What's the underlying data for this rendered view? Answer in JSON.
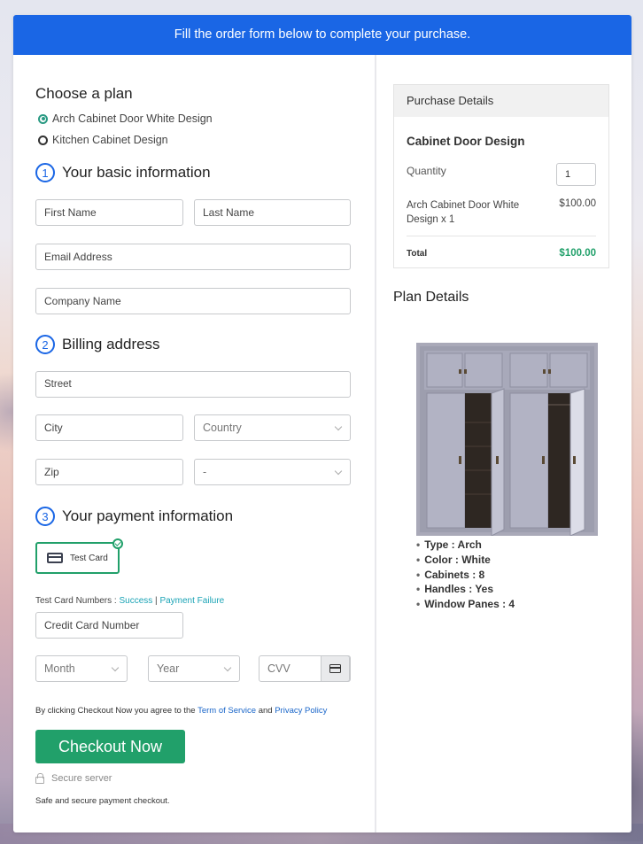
{
  "banner": {
    "text": "Fill the order form below to complete your purchase."
  },
  "plan": {
    "heading": "Choose a plan",
    "options": [
      {
        "label": "Arch Cabinet Door White Design",
        "selected": true
      },
      {
        "label": "Kitchen Cabinet Design",
        "selected": false
      }
    ]
  },
  "basic_info": {
    "step": "1",
    "heading": "Your basic information",
    "first_name_placeholder": "First Name",
    "last_name_placeholder": "Last Name",
    "email_placeholder": "Email Address",
    "company_placeholder": "Company Name"
  },
  "billing": {
    "step": "2",
    "heading": "Billing address",
    "street_placeholder": "Street",
    "city_placeholder": "City",
    "country_select": "Country",
    "zip_placeholder": "Zip",
    "state_select": "-"
  },
  "payment": {
    "step": "3",
    "heading": "Your payment information",
    "method_label": "Test Card",
    "test_numbers_label": "Test Card Numbers : ",
    "success_link": "Success",
    "separator": " | ",
    "failure_link": "Payment Failure",
    "card_number_placeholder": "Credit Card Number",
    "month_select": "Month",
    "year_select": "Year",
    "cvv_placeholder": "CVV"
  },
  "checkout": {
    "terms_prefix": "By clicking Checkout Now you agree to the ",
    "terms_link": "Term of Service",
    "terms_and": " and ",
    "privacy_link": "Privacy Policy",
    "button_label": "Checkout Now",
    "secure_label": "Secure server",
    "safe_text": "Safe and secure payment checkout."
  },
  "purchase": {
    "heading": "Purchase Details",
    "product": "Cabinet Door Design",
    "quantity_label": "Quantity",
    "quantity": "1",
    "item_label": "Arch Cabinet Door White Design x 1",
    "item_price": "$100.00",
    "total_label": "Total",
    "total": "$100.00"
  },
  "plan_details": {
    "heading": "Plan Details",
    "image_alt": "white cabinet with open doors",
    "features": [
      "Type : Arch",
      "Color : White",
      "Cabinets : 8",
      "Handles : Yes",
      "Window Panes : 4"
    ]
  },
  "colors": {
    "brand_blue": "#1a66e5",
    "accent_green": "#21a06a",
    "link_teal": "#1aa3b5"
  }
}
